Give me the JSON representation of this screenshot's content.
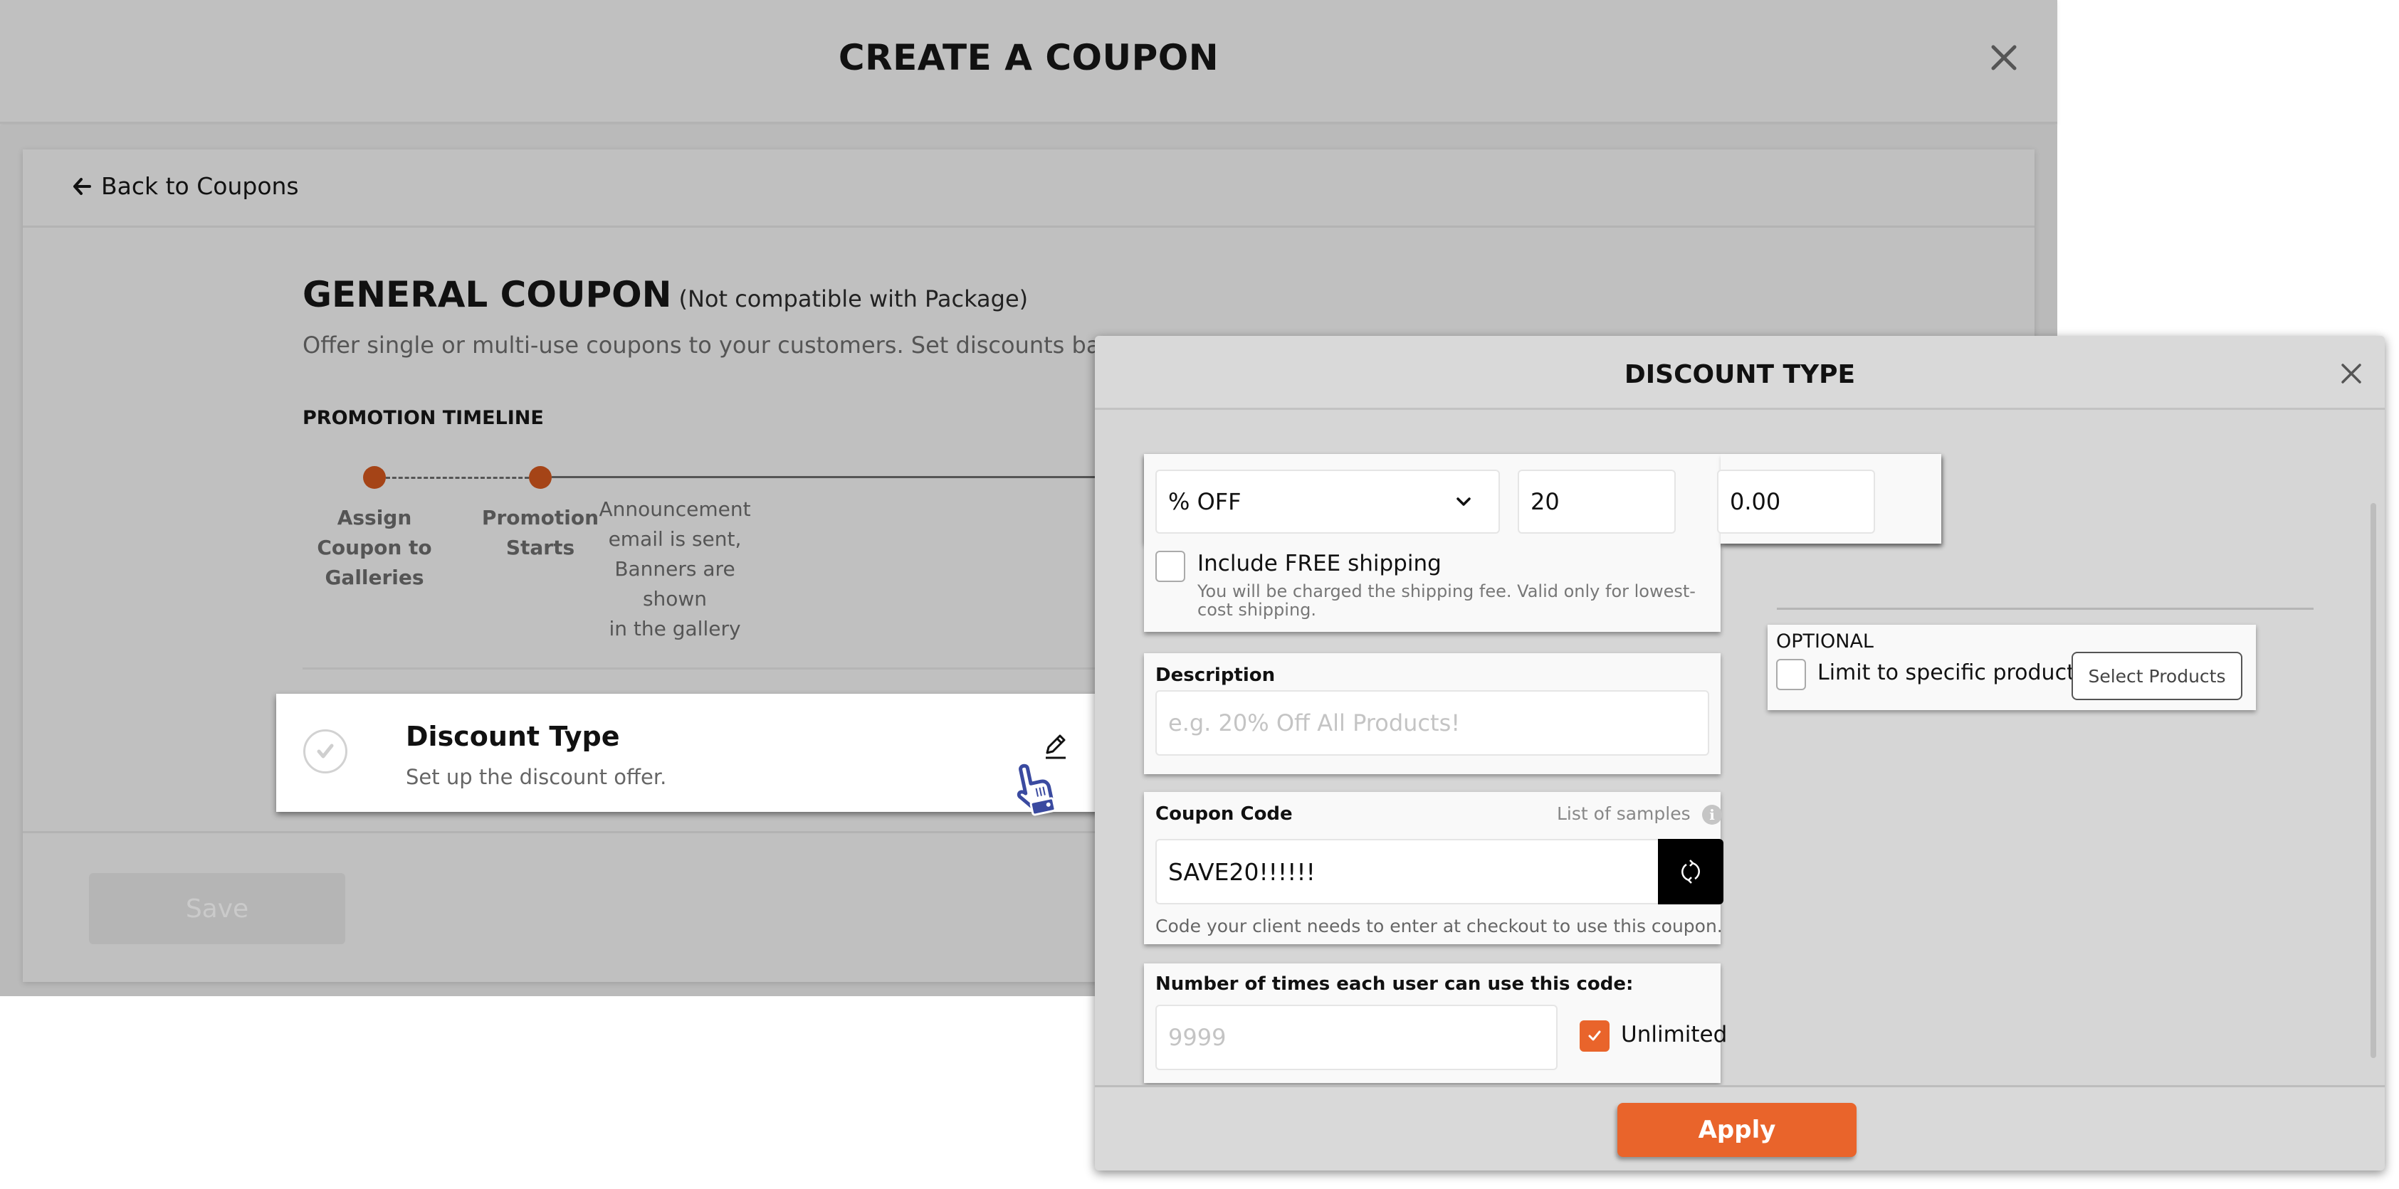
{
  "background_page": {
    "title": "CREATE A COUPON",
    "back_link": "Back to Coupons",
    "coupon_title": "GENERAL COUPON",
    "coupon_subtitle": "(Not compatible with Package)",
    "coupon_description": "Offer single or multi-use coupons to your customers. Set discounts based on p",
    "timeline_heading": "PROMOTION TIMELINE",
    "timeline_steps": [
      {
        "label": "Assign Coupon to Galleries",
        "lines": [
          "Assign",
          "Coupon to",
          "Galleries"
        ]
      },
      {
        "label": "Promotion Starts",
        "lines": [
          "Promotion",
          "Starts"
        ]
      },
      {
        "label": "Announcement email is sent, Banners are shown in the gallery",
        "lines": [
          "Announcement",
          "email is sent,",
          "Banners are shown",
          "in the gallery"
        ]
      }
    ],
    "section_card": {
      "title": "Discount Type",
      "subtitle": "Set up the discount offer."
    },
    "save_label": "Save"
  },
  "modal": {
    "title": "DISCOUNT TYPE",
    "discount_type_selected": "% OFF",
    "discount_value": "20",
    "min_amount_value": "0.00",
    "free_shipping": {
      "label": "Include FREE shipping",
      "checked": false,
      "hint": "You will be charged the shipping fee. Valid only for lowest-cost shipping."
    },
    "description": {
      "label": "Description",
      "placeholder": "e.g. 20% Off All Products!",
      "value": ""
    },
    "coupon_code": {
      "label": "Coupon Code",
      "samples_link": "List of samples",
      "value": "SAVE20!!!!!!",
      "hint": "Code your client needs to enter at checkout to use this coupon."
    },
    "usage_limit": {
      "label": "Number of times each user can use this code:",
      "placeholder": "9999",
      "value": "",
      "unlimited_label": "Unlimited",
      "unlimited_checked": true
    },
    "optional": {
      "heading": "OPTIONAL",
      "limit_label": "Limit to specific products",
      "limit_checked": false,
      "select_products_label": "Select Products"
    },
    "apply_label": "Apply"
  },
  "colors": {
    "accent": "#e9642b",
    "timeline_dot": "#a54417",
    "cursor_blue": "#3a4aa0"
  }
}
